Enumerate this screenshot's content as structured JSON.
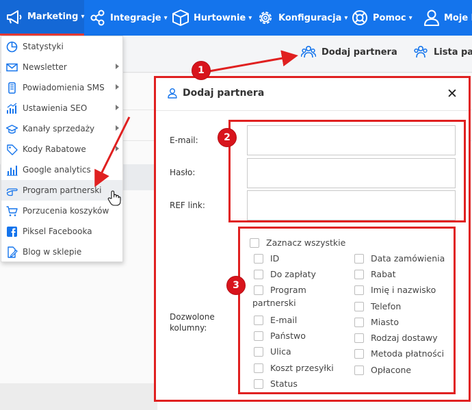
{
  "topnav": {
    "items": [
      {
        "label": "Marketing",
        "icon": "megaphone-icon",
        "active": true
      },
      {
        "label": "Integracje",
        "icon": "share-nodes-icon"
      },
      {
        "label": "Hurtownie",
        "icon": "box-icon"
      },
      {
        "label": "Konfiguracja",
        "icon": "gear-icon"
      },
      {
        "label": "Pomoc",
        "icon": "lifebuoy-icon"
      },
      {
        "label": "Moje k",
        "icon": "user-icon"
      }
    ]
  },
  "actions": {
    "add_partner": "Dodaj partnera",
    "partner_list": "Lista pa"
  },
  "menu": {
    "items": [
      {
        "label": "Statystyki",
        "icon": "pie-chart-icon",
        "submenu": false
      },
      {
        "label": "Newsletter",
        "icon": "envelope-icon",
        "submenu": true
      },
      {
        "label": "Powiadomienia SMS",
        "icon": "phone-icon",
        "submenu": true
      },
      {
        "label": "Ustawienia SEO",
        "icon": "bar-chart-up-icon",
        "submenu": true
      },
      {
        "label": "Kanały sprzedaży",
        "icon": "graduation-cap-icon",
        "submenu": true
      },
      {
        "label": "Kody Rabatowe",
        "icon": "tag-icon",
        "submenu": true
      },
      {
        "label": "Google analytics",
        "icon": "bar-chart-icon",
        "submenu": false
      },
      {
        "label": "Program partnerski",
        "icon": "pointing-hand-icon",
        "submenu": false,
        "hovered": true
      },
      {
        "label": "Porzucenia koszyków",
        "icon": "cart-icon",
        "submenu": false
      },
      {
        "label": "Piksel Facebooka",
        "icon": "facebook-icon",
        "submenu": false
      },
      {
        "label": "Blog w sklepie",
        "icon": "edit-document-icon",
        "submenu": false
      }
    ]
  },
  "modal": {
    "title": "Dodaj partnera",
    "close_glyph": "✕",
    "fields": {
      "email_label": "E-mail:",
      "email_value": "",
      "password_label": "Hasło:",
      "password_value": "",
      "ref_label": "REF link:",
      "ref_value": ""
    },
    "columns": {
      "label_line1": "Dozwolone",
      "label_line2": "kolumny:",
      "select_all": "Zaznacz wszystkie",
      "left": [
        "ID",
        "Do zapłaty",
        "Program",
        "E-mail",
        "Państwo",
        "Ulica",
        "Koszt przesyłki",
        "Status"
      ],
      "program_line2": "partnerski",
      "right": [
        "Data zamówienia",
        "Rabat",
        "Imię i nazwisko",
        "Telefon",
        "Miasto",
        "Rodzaj dostawy",
        "Metoda płatności",
        "Opłacone"
      ]
    }
  },
  "badges": [
    "1",
    "2",
    "3"
  ],
  "colors": {
    "nav_blue": "#1474ec",
    "annotation_red": "#e02020",
    "badge_red": "#d8141c",
    "icon_blue": "#1474ec"
  }
}
